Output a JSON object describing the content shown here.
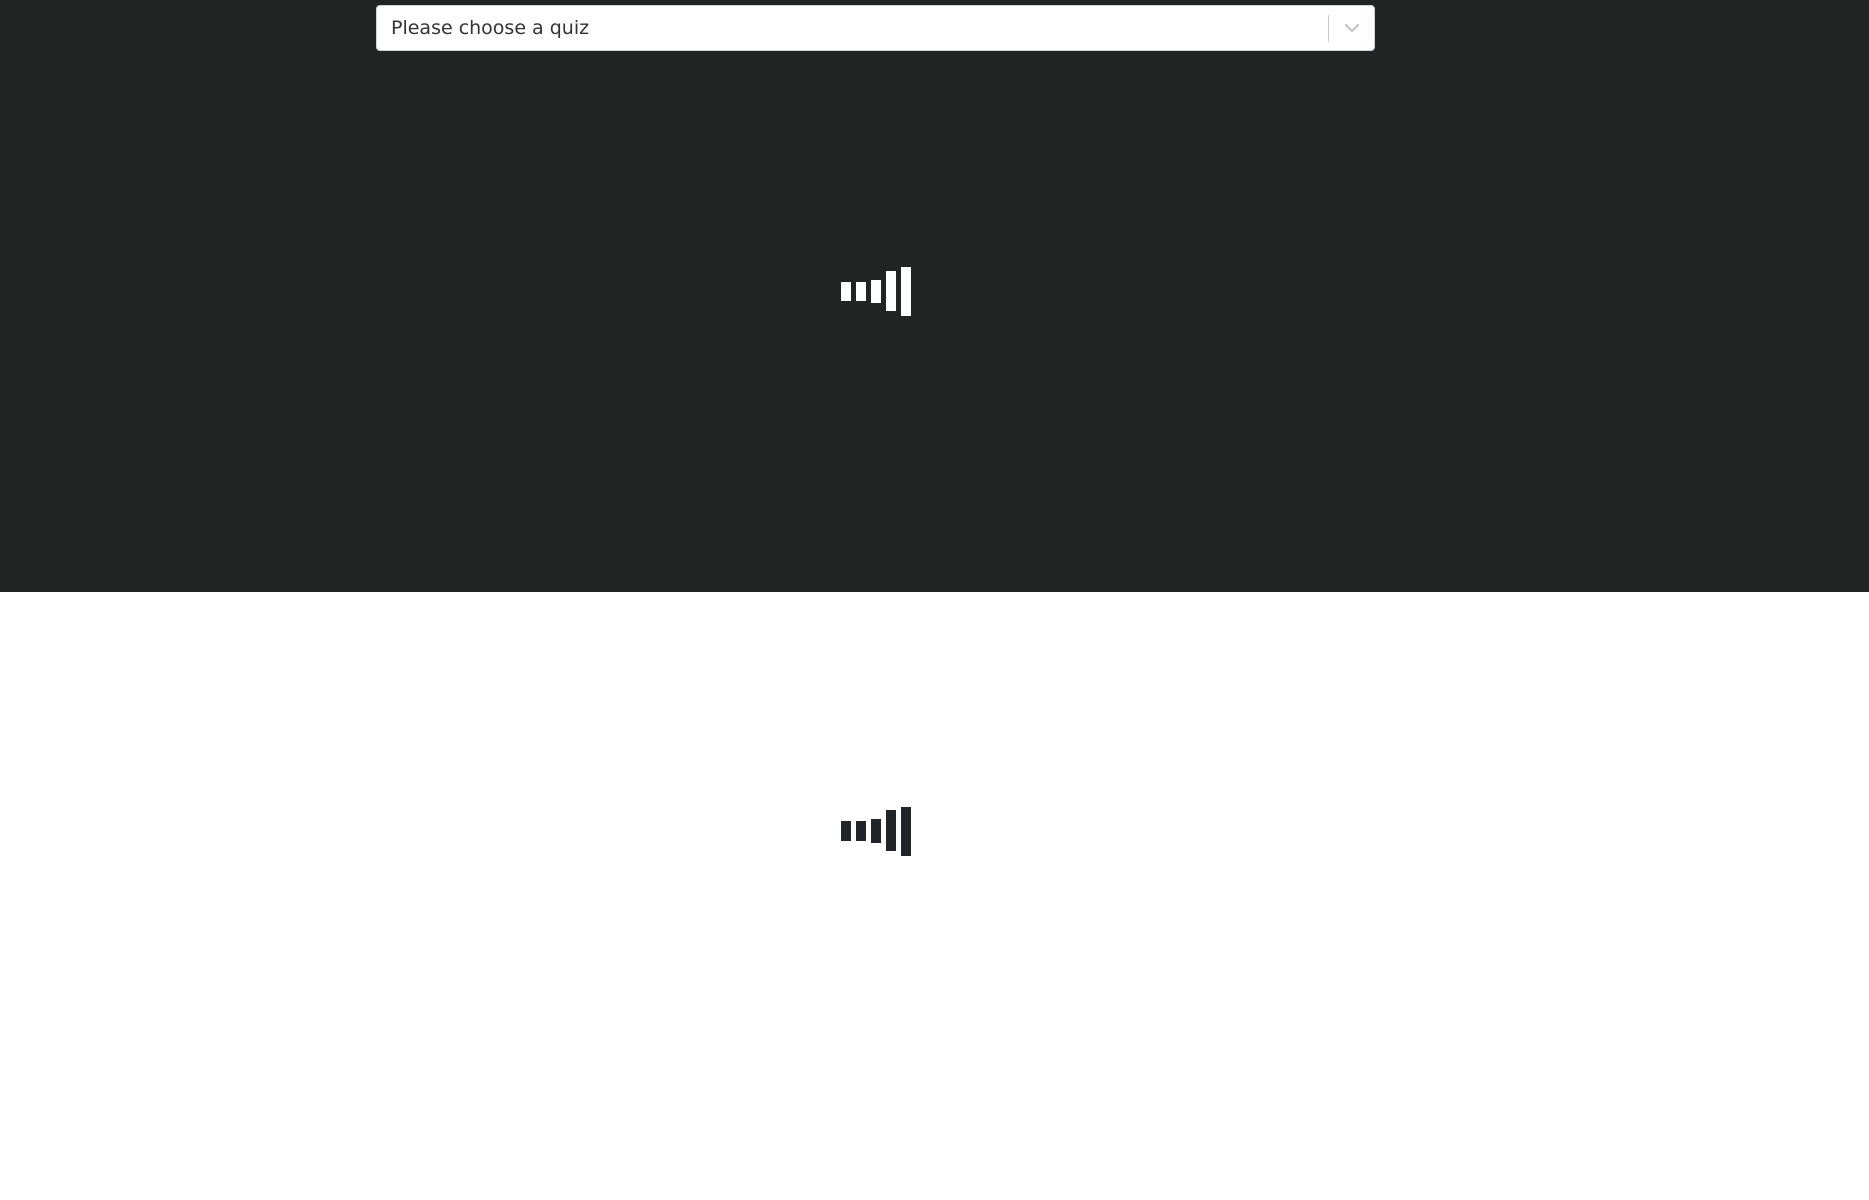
{
  "quiz_select": {
    "value": "Please choose a quiz",
    "icon": "chevron-down-icon"
  },
  "colors": {
    "top_background": "#222423",
    "bottom_background": "#ffffff",
    "loader_light": "#ffffff",
    "loader_dark": "#212529"
  },
  "loaders": [
    {
      "name": "top-loading-indicator",
      "icon": "loading-bars-icon",
      "color": "#ffffff"
    },
    {
      "name": "bottom-loading-indicator",
      "icon": "loading-bars-icon",
      "color": "#212529"
    }
  ]
}
